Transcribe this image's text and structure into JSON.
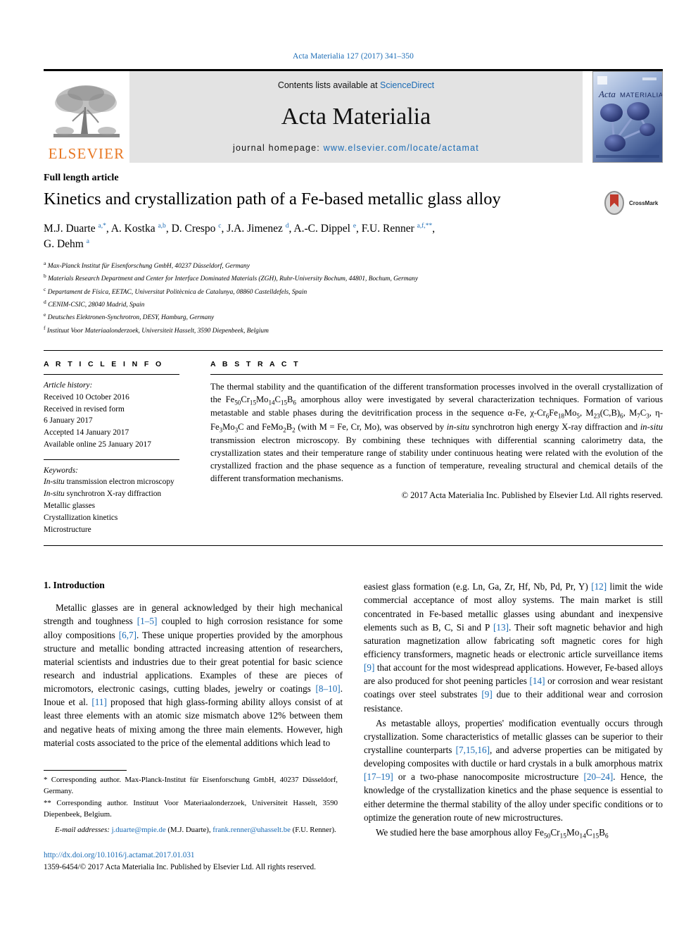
{
  "header": {
    "journal_ref": "Acta Materialia 127 (2017) 341–350",
    "contents_prefix": "Contents lists available at ",
    "sciencedirect": "ScienceDirect",
    "journal_title": "Acta Materialia",
    "homepage_prefix": "journal homepage: ",
    "homepage_url": "www.elsevier.com/locate/actamat",
    "publisher_logo_text": "ELSEVIER",
    "cover_title_italic": "Acta",
    "cover_title_rest": "MATERIALIA"
  },
  "article": {
    "type": "Full length article",
    "title": "Kinetics and crystallization path of a Fe-based metallic glass alloy",
    "crossmark_label": "CrossMark",
    "authors_line1": "M.J. Duarte a,*, A. Kostka a,b, D. Crespo c, J.A. Jimenez d, A.-C. Dippel e, F.U. Renner a,f,**,",
    "authors_line2": "G. Dehm a",
    "affiliations": [
      {
        "marker": "a",
        "text": "Max-Planck Institut für Eisenforschung GmbH, 40237 Düsseldorf, Germany"
      },
      {
        "marker": "b",
        "text": "Materials Research Department and Center for Interface Dominated Materials (ZGH), Ruhr-University Bochum, 44801, Bochum, Germany"
      },
      {
        "marker": "c",
        "text": "Departament de Física, EETAC, Universitat Politècnica de Catalunya, 08860 Castelldefels, Spain"
      },
      {
        "marker": "d",
        "text": "CENIM-CSIC, 28040 Madrid, Spain"
      },
      {
        "marker": "e",
        "text": "Deutsches Elektronen-Synchrotron, DESY, Hamburg, Germany"
      },
      {
        "marker": "f",
        "text": "Instituut Voor Materiaalonderzoek, Universiteit Hasselt, 3590 Diepenbeek, Belgium"
      }
    ]
  },
  "info": {
    "heading": "A R T I C L E  I N F O",
    "history_label": "Article history:",
    "history": [
      "Received 10 October 2016",
      "Received in revised form",
      "6 January 2017",
      "Accepted 14 January 2017",
      "Available online 25 January 2017"
    ],
    "keywords_label": "Keywords:",
    "keywords": [
      "In-situ transmission electron microscopy",
      "In-situ synchrotron X-ray diffraction",
      "Metallic glasses",
      "Crystallization kinetics",
      "Microstructure"
    ]
  },
  "abstract": {
    "heading": "A B S T R A C T",
    "text": "The thermal stability and the quantification of the different transformation processes involved in the overall crystallization of the Fe50Cr15Mo14C15B6 amorphous alloy were investigated by several characterization techniques. Formation of various metastable and stable phases during the devitrification process in the sequence α-Fe, χ-Cr6Fe18Mo5, M23(C,B)6, M7C3, η-Fe3Mo3C and FeMo2B2 (with M = Fe, Cr, Mo), was observed by in-situ synchrotron high energy X-ray diffraction and in-situ transmission electron microscopy. By combining these techniques with differential scanning calorimetry data, the crystallization states and their temperature range of stability under continuous heating were related with the evolution of the crystallized fraction and the phase sequence as a function of temperature, revealing structural and chemical details of the different transformation mechanisms.",
    "copyright": "© 2017 Acta Materialia Inc. Published by Elsevier Ltd. All rights reserved."
  },
  "body": {
    "section_number_title": "1. Introduction",
    "left_paragraphs": [
      "Metallic glasses are in general acknowledged by their high mechanical strength and toughness [1–5] coupled to high corrosion resistance for some alloy compositions [6,7]. These unique properties provided by the amorphous structure and metallic bonding attracted increasing attention of researchers, material scientists and industries due to their great potential for basic science research and industrial applications. Examples of these are pieces of micromotors, electronic casings, cutting blades, jewelry or coatings [8–10]. Inoue et al. [11] proposed that high glass-forming ability alloys consist of at least three elements with an atomic size mismatch above 12% between them and negative heats of mixing among the three main elements. However, high material costs associated to the price of the elemental additions which lead to"
    ],
    "right_paragraphs": [
      "easiest glass formation (e.g. Ln, Ga, Zr, Hf, Nb, Pd, Pr, Y) [12] limit the wide commercial acceptance of most alloy systems. The main market is still concentrated in Fe-based metallic glasses using abundant and inexpensive elements such as B, C, Si and P [13]. Their soft magnetic behavior and high saturation magnetization allow fabricating soft magnetic cores for high efficiency transformers, magnetic heads or electronic article surveillance items [9] that account for the most widespread applications. However, Fe-based alloys are also produced for shot peening particles [14] or corrosion and wear resistant coatings over steel substrates [9] due to their additional wear and corrosion resistance.",
      "As metastable alloys, properties' modification eventually occurs through crystallization. Some characteristics of metallic glasses can be superior to their crystalline counterparts [7,15,16], and adverse properties can be mitigated by developing composites with ductile or hard crystals in a bulk amorphous matrix [17–19] or a two-phase nanocomposite microstructure [20–24]. Hence, the knowledge of the crystallization kinetics and the phase sequence is essential to either determine the thermal stability of the alloy under specific conditions or to optimize the generation route of new microstructures.",
      "We studied here the base amorphous alloy Fe50Cr15Mo14C15B6"
    ]
  },
  "footnotes": {
    "corresponding_1": "* Corresponding author. Max-Planck-Institut für Eisenforschung GmbH, 40237 Düsseldorf, Germany.",
    "corresponding_2": "** Corresponding author. Instituut Voor Materiaalonderzoek, Universiteit Hasselt, 3590 Diepenbeek, Belgium.",
    "email_label": "E-mail addresses:",
    "email_1": "j.duarte@mpie.de",
    "email_1_owner": "(M.J. Duarte),",
    "email_2": "frank.renner@uhasselt.be",
    "email_2_owner": "(F.U. Renner)."
  },
  "footer": {
    "doi": "http://dx.doi.org/10.1016/j.actamat.2017.01.031",
    "issn_line": "1359-6454/© 2017 Acta Materialia Inc. Published by Elsevier Ltd. All rights reserved."
  },
  "colors": {
    "link": "#1a6bb5",
    "elsevier_orange": "#E87722",
    "panel_gray": "#e3e3e3"
  }
}
